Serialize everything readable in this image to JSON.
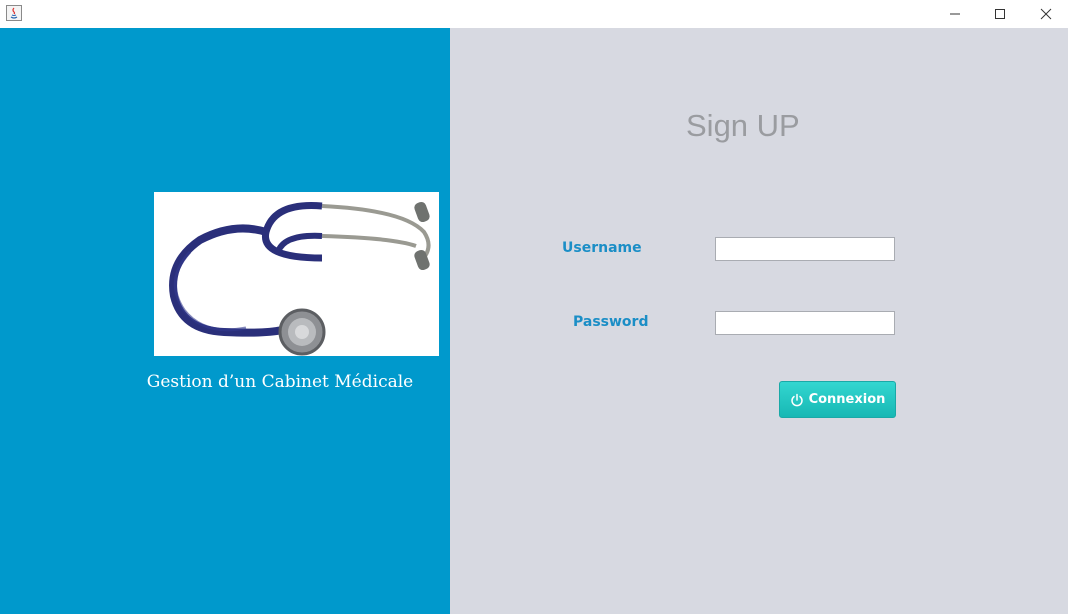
{
  "window": {
    "controls": {
      "minimize": "minimize",
      "maximize": "maximize",
      "close": "close"
    }
  },
  "brand": {
    "tagline": "Gestion d’un Cabinet Médicale",
    "image": "stethoscope"
  },
  "form": {
    "title": "Sign UP",
    "username_label": "Username",
    "username_value": "",
    "password_label": "Password",
    "password_value": "",
    "submit_label": "Connexion",
    "submit_icon": "power-icon"
  },
  "colors": {
    "left_panel": "#0099cc",
    "right_panel": "#d7d9e1",
    "label": "#1b8ec6",
    "title": "#9a9ca0",
    "button": "#1fc4c0"
  }
}
